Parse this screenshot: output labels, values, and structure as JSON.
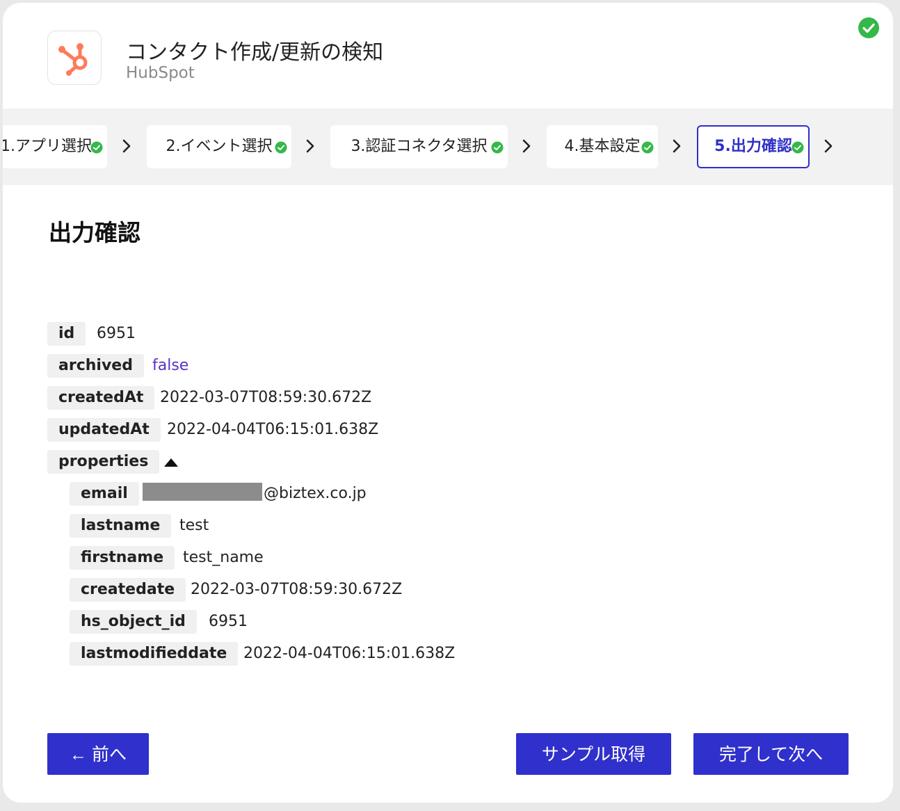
{
  "header": {
    "title": "コンタクト作成/更新の検知",
    "app_name": "HubSpot",
    "app_brand_color": "#ff7a59",
    "status": "complete"
  },
  "steps": [
    {
      "label": "1.アプリ選択",
      "completed": true,
      "active": false
    },
    {
      "label": "2.イベント選択",
      "completed": true,
      "active": false
    },
    {
      "label": "3.認証コネクタ選択",
      "completed": true,
      "active": false
    },
    {
      "label": "4.基本設定",
      "completed": true,
      "active": false
    },
    {
      "label": "5.出力確認",
      "completed": true,
      "active": true
    }
  ],
  "section_title": "出力確認",
  "output": {
    "id": {
      "key": "id",
      "value": "6951"
    },
    "archived": {
      "key": "archived",
      "value": "false"
    },
    "createdAt": {
      "key": "createdAt",
      "value": "2022-03-07T08:59:30.672Z"
    },
    "updatedAt": {
      "key": "updatedAt",
      "value": "2022-04-04T06:15:01.638Z"
    },
    "properties": {
      "key": "properties",
      "expanded": true,
      "email": {
        "key": "email",
        "value": "@biztex.co.jp"
      },
      "lastname": {
        "key": "lastname",
        "value": "test"
      },
      "firstname": {
        "key": "firstname",
        "value": "test_name"
      },
      "createdate": {
        "key": "createdate",
        "value": "2022-03-07T08:59:30.672Z"
      },
      "hs_object_id": {
        "key": "hs_object_id",
        "value": "6951"
      },
      "lastmodifieddate": {
        "key": "lastmodifieddate",
        "value": "2022-04-04T06:15:01.638Z"
      }
    }
  },
  "buttons": {
    "prev": "← 前へ",
    "sample": "サンプル取得",
    "next": "完了して次へ"
  },
  "colors": {
    "primary": "#3030cc",
    "success": "#34b84a",
    "boolean_value": "#5a2fc8"
  }
}
